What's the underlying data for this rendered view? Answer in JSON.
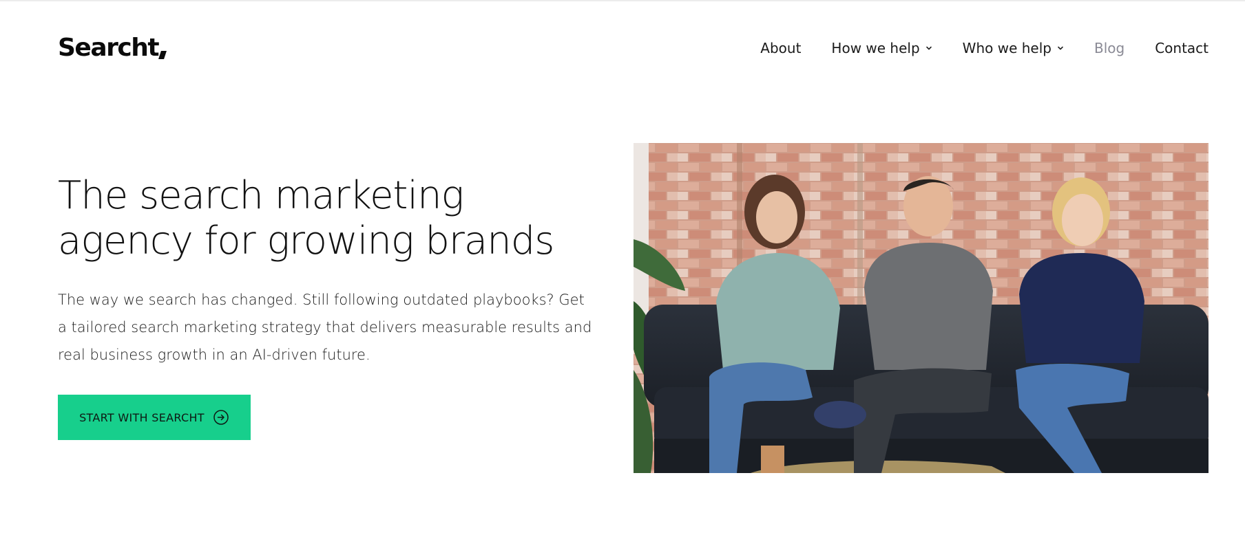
{
  "brand": {
    "logo_text": "Searcht"
  },
  "nav": {
    "items": [
      {
        "label": "About"
      },
      {
        "label": "How we help"
      },
      {
        "label": "Who we help"
      },
      {
        "label": "Blog"
      },
      {
        "label": "Contact"
      }
    ]
  },
  "hero": {
    "title_lines": [
      "The search marketing",
      "agency for growing brands"
    ],
    "description_lines": [
      "The way we search has changed. Still following outdated playbooks? Get",
      "a tailored search marketing strategy that delivers measurable results and",
      "real business growth in an AI-driven future."
    ],
    "cta_label": "START WITH SEARCHT"
  },
  "colors": {
    "accent": "#17cf8c",
    "text": "#111111",
    "muted_nav": "#8a8a95"
  },
  "icons": {
    "chevron": "chevron-down-icon",
    "cta": "arrow-circle-right-icon"
  }
}
